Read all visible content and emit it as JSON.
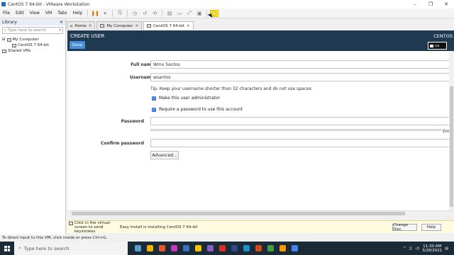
{
  "window": {
    "title": "CentOS 7 64-bit - VMware Workstation",
    "controls": [
      "–",
      "❐",
      "✕"
    ]
  },
  "menu": [
    "File",
    "Edit",
    "View",
    "VM",
    "Tabs",
    "Help"
  ],
  "library": {
    "title": "Library",
    "search_placeholder": "Type here to search",
    "tree": {
      "root": "My Computer",
      "vm": "CentOS 7 64-bit",
      "shared": "Shared VMs"
    }
  },
  "tabs": [
    {
      "label": "Home"
    },
    {
      "label": "My Computer"
    },
    {
      "label": "CentOS 7 64-bit",
      "active": true
    }
  ],
  "installer": {
    "title": "CREATE USER",
    "os_label": "CENTOS",
    "done_label": "Done",
    "keyboard": "us",
    "full_name_label": "Full name",
    "full_name_value": "Wmx Santos",
    "username_label": "Username",
    "username_value": "wsantos",
    "tip": "Tip: Keep your username shorter than 32 characters and do not use spaces.",
    "admin_checkbox": "Make this user administrator",
    "password_checkbox": "Require a password to use this account",
    "password_label": "Password",
    "confirm_label": "Confirm password",
    "strength_text": "Em",
    "advanced_label": "Advanced..."
  },
  "status_bar": {
    "hint": "Click in the virtual screen to send keystrokes",
    "message": "Easy Install is installing CentOS 7 64-bit",
    "change_disc": "Change Disc",
    "help": "Help"
  },
  "bottom_status": "To direct input to this VM, click inside or press Ctrl+G.",
  "taskbar": {
    "search_placeholder": "Type here to search",
    "time": "11:30 AM",
    "date": "3/28/2021",
    "app_colors": [
      "#5b9bd5",
      "#f0b400",
      "#e8562a",
      "#c239b3",
      "#3c6ebf",
      "#f5c400",
      "#8661c5",
      "#d93025",
      "#2c4a8a",
      "#1e90c8",
      "#d04a1d",
      "#42a042",
      "#f59b00",
      "#4285f4"
    ]
  },
  "colors": {
    "vm_header": "#1f3a50",
    "done_button": "#4a90d9",
    "highlight": "#ffe838",
    "taskbar": "#1a2a36"
  }
}
